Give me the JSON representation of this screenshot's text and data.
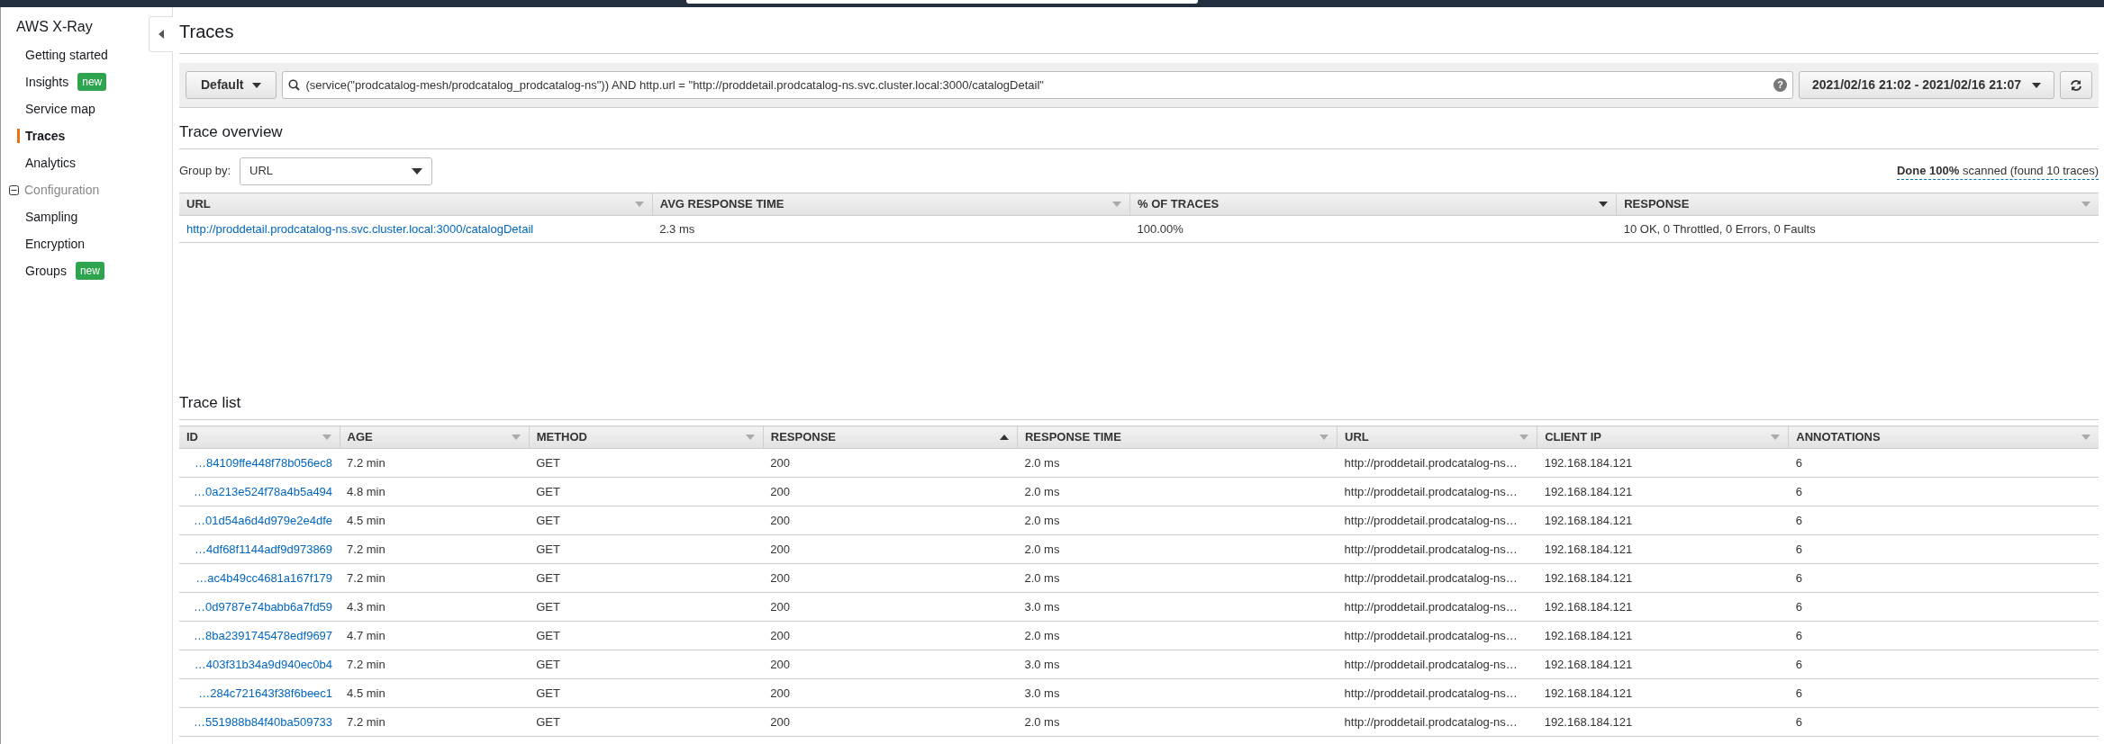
{
  "sidebar": {
    "title": "AWS X-Ray",
    "items": [
      {
        "kind": "link",
        "label": "Getting started",
        "selected": false
      },
      {
        "kind": "link",
        "label": "Insights",
        "selected": false,
        "badge": "new"
      },
      {
        "kind": "link",
        "label": "Service map",
        "selected": false
      },
      {
        "kind": "link",
        "label": "Traces",
        "selected": true
      },
      {
        "kind": "link",
        "label": "Analytics",
        "selected": false
      },
      {
        "kind": "section",
        "label": "Configuration",
        "expanded": true,
        "selected": false
      },
      {
        "kind": "link",
        "label": "Sampling",
        "selected": false
      },
      {
        "kind": "link",
        "label": "Encryption",
        "selected": false
      },
      {
        "kind": "link",
        "label": "Groups",
        "selected": false,
        "badge": "new"
      }
    ]
  },
  "page": {
    "title": "Traces"
  },
  "help_icon": "?",
  "toolbar": {
    "group_button": "Default",
    "query": "(service(\"prodcatalog-mesh/prodcatalog_prodcatalog-ns\")) AND http.url = \"http://proddetail.prodcatalog-ns.svc.cluster.local:3000/catalogDetail\"",
    "time_range": "2021/02/16 21:02 - 2021/02/16 21:07"
  },
  "overview": {
    "title": "Trace overview",
    "group_by_label": "Group by:",
    "group_by_value": "URL",
    "scan_status": "**Done 100%** scanned (found 10 traces)",
    "columns": [
      {
        "label": "URL",
        "sorted": false
      },
      {
        "label": "AVG RESPONSE TIME",
        "sorted": false
      },
      {
        "label": "% OF TRACES",
        "sorted": true,
        "ascending": false
      },
      {
        "label": "RESPONSE",
        "sorted": false
      }
    ],
    "rows": [
      {
        "url": "http://proddetail.prodcatalog-ns.svc.cluster.local:3000/catalogDetail",
        "avg_response_time": "2.3 ms",
        "percent": "100.00%",
        "response": "10 OK, 0 Throttled, 0 Errors, 0 Faults"
      }
    ]
  },
  "trace_list": {
    "title": "Trace list",
    "columns": [
      {
        "label": "ID",
        "sorted": false
      },
      {
        "label": "AGE",
        "sorted": false
      },
      {
        "label": "METHOD",
        "sorted": false
      },
      {
        "label": "RESPONSE",
        "sorted": true,
        "ascending": true
      },
      {
        "label": "RESPONSE TIME",
        "sorted": false
      },
      {
        "label": "URL",
        "sorted": false
      },
      {
        "label": "CLIENT IP",
        "sorted": false
      },
      {
        "label": "ANNOTATIONS",
        "sorted": false
      }
    ],
    "rows": [
      {
        "id": "…84109ffe448f78b056ec8",
        "age": "7.2 min",
        "method": "GET",
        "response": "200",
        "response_time": "2.0 ms",
        "url": "http://proddetail.prodcatalog-ns…",
        "client_ip": "192.168.184.121",
        "annotations": "6"
      },
      {
        "id": "…0a213e524f78a4b5a494",
        "age": "4.8 min",
        "method": "GET",
        "response": "200",
        "response_time": "2.0 ms",
        "url": "http://proddetail.prodcatalog-ns…",
        "client_ip": "192.168.184.121",
        "annotations": "6"
      },
      {
        "id": "…01d54a6d4d979e2e4dfe",
        "age": "4.5 min",
        "method": "GET",
        "response": "200",
        "response_time": "2.0 ms",
        "url": "http://proddetail.prodcatalog-ns…",
        "client_ip": "192.168.184.121",
        "annotations": "6"
      },
      {
        "id": "…4df68f1144adf9d973869",
        "age": "7.2 min",
        "method": "GET",
        "response": "200",
        "response_time": "2.0 ms",
        "url": "http://proddetail.prodcatalog-ns…",
        "client_ip": "192.168.184.121",
        "annotations": "6"
      },
      {
        "id": "…ac4b49cc4681a167f179",
        "age": "7.2 min",
        "method": "GET",
        "response": "200",
        "response_time": "2.0 ms",
        "url": "http://proddetail.prodcatalog-ns…",
        "client_ip": "192.168.184.121",
        "annotations": "6"
      },
      {
        "id": "…0d9787e74babb6a7fd59",
        "age": "4.3 min",
        "method": "GET",
        "response": "200",
        "response_time": "3.0 ms",
        "url": "http://proddetail.prodcatalog-ns…",
        "client_ip": "192.168.184.121",
        "annotations": "6"
      },
      {
        "id": "…8ba2391745478edf9697",
        "age": "4.7 min",
        "method": "GET",
        "response": "200",
        "response_time": "2.0 ms",
        "url": "http://proddetail.prodcatalog-ns…",
        "client_ip": "192.168.184.121",
        "annotations": "6"
      },
      {
        "id": "…403f31b34a9d940ec0b4",
        "age": "7.2 min",
        "method": "GET",
        "response": "200",
        "response_time": "3.0 ms",
        "url": "http://proddetail.prodcatalog-ns…",
        "client_ip": "192.168.184.121",
        "annotations": "6"
      },
      {
        "id": "…284c721643f38f6beec1",
        "age": "4.5 min",
        "method": "GET",
        "response": "200",
        "response_time": "3.0 ms",
        "url": "http://proddetail.prodcatalog-ns…",
        "client_ip": "192.168.184.121",
        "annotations": "6"
      },
      {
        "id": "…551988b84f40ba509733",
        "age": "7.2 min",
        "method": "GET",
        "response": "200",
        "response_time": "2.0 ms",
        "url": "http://proddetail.prodcatalog-ns…",
        "client_ip": "192.168.184.121",
        "annotations": "6"
      }
    ]
  }
}
